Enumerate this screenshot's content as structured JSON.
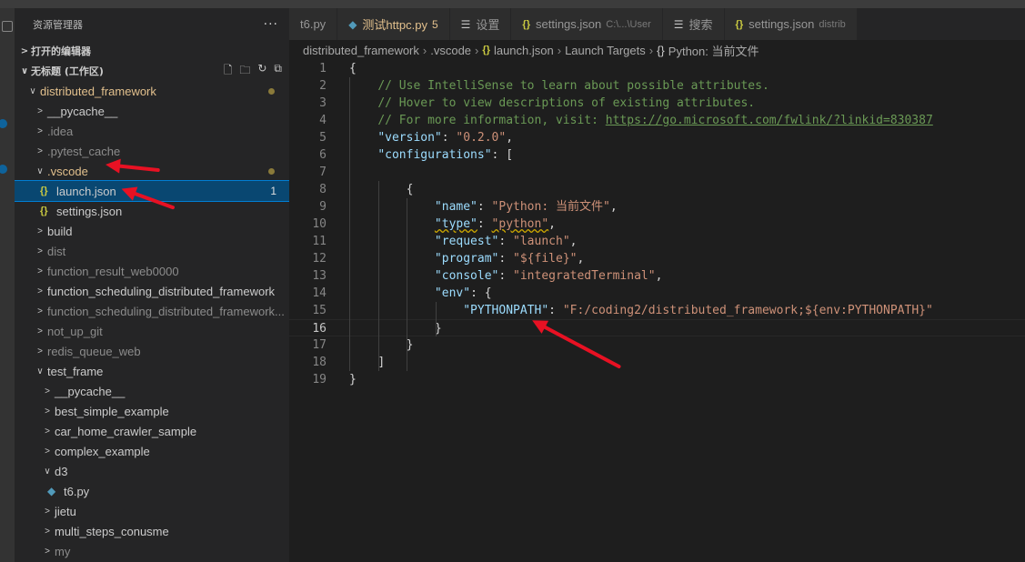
{
  "sidebar": {
    "title": "资源管理器",
    "open_editors_label": "打开的编辑器",
    "workspace_label": "无标题 (工作区)",
    "tree": [
      {
        "label": "distributed_framework",
        "chev": "∨",
        "indent": 1,
        "kind": "folder",
        "modified": true
      },
      {
        "label": "__pycache__",
        "chev": ">",
        "indent": 2,
        "kind": "folder",
        "ignored": false
      },
      {
        "label": ".idea",
        "chev": ">",
        "indent": 2,
        "kind": "folder",
        "ignored": true
      },
      {
        "label": ".pytest_cache",
        "chev": ">",
        "indent": 2,
        "kind": "folder",
        "ignored": true
      },
      {
        "label": ".vscode",
        "chev": "∨",
        "indent": 2,
        "kind": "folder",
        "modified": true
      },
      {
        "label": "launch.json",
        "indent": 3,
        "kind": "json",
        "selected": true,
        "count": "1"
      },
      {
        "label": "settings.json",
        "indent": 3,
        "kind": "json"
      },
      {
        "label": "build",
        "chev": ">",
        "indent": 2,
        "kind": "folder"
      },
      {
        "label": "dist",
        "chev": ">",
        "indent": 2,
        "kind": "folder",
        "ignored": true
      },
      {
        "label": "function_result_web0000",
        "chev": ">",
        "indent": 2,
        "kind": "folder",
        "ignored": true
      },
      {
        "label": "function_scheduling_distributed_framework",
        "chev": ">",
        "indent": 2,
        "kind": "folder"
      },
      {
        "label": "function_scheduling_distributed_framework...",
        "chev": ">",
        "indent": 2,
        "kind": "folder",
        "ignored": true
      },
      {
        "label": "not_up_git",
        "chev": ">",
        "indent": 2,
        "kind": "folder",
        "ignored": true
      },
      {
        "label": "redis_queue_web",
        "chev": ">",
        "indent": 2,
        "kind": "folder",
        "ignored": true
      },
      {
        "label": "test_frame",
        "chev": "∨",
        "indent": 2,
        "kind": "folder"
      },
      {
        "label": "__pycache__",
        "chev": ">",
        "indent": 3,
        "kind": "folder"
      },
      {
        "label": "best_simple_example",
        "chev": ">",
        "indent": 3,
        "kind": "folder"
      },
      {
        "label": "car_home_crawler_sample",
        "chev": ">",
        "indent": 3,
        "kind": "folder"
      },
      {
        "label": "complex_example",
        "chev": ">",
        "indent": 3,
        "kind": "folder"
      },
      {
        "label": "d3",
        "chev": "∨",
        "indent": 3,
        "kind": "folder"
      },
      {
        "label": "t6.py",
        "indent": 4,
        "kind": "py"
      },
      {
        "label": "jietu",
        "chev": ">",
        "indent": 3,
        "kind": "folder"
      },
      {
        "label": "multi_steps_conusme",
        "chev": ">",
        "indent": 3,
        "kind": "folder"
      },
      {
        "label": "my",
        "chev": ">",
        "indent": 3,
        "kind": "folder",
        "ignored": true
      }
    ]
  },
  "tabs": [
    {
      "label": "t6.py",
      "icon": ""
    },
    {
      "label": "测试httpc.py",
      "icon": "python-icon",
      "badge": "5",
      "modified": true
    },
    {
      "label": "设置",
      "icon": "settings-icon"
    },
    {
      "label": "settings.json",
      "icon": "json-icon",
      "desc": "C:\\...\\User"
    },
    {
      "label": "搜索",
      "icon": "search-icon"
    },
    {
      "label": "settings.json",
      "icon": "json-icon",
      "desc": "distrib"
    }
  ],
  "breadcrumb": [
    "distributed_framework",
    ".vscode",
    "launch.json",
    "Launch Targets",
    "Python: 当前文件"
  ],
  "editor": {
    "active_line": 16,
    "lines": [
      [
        [
          "{",
          "t-pun"
        ]
      ],
      [
        [
          "    ",
          ""
        ],
        [
          "// Use IntelliSense to learn about possible attributes.",
          "t-com"
        ]
      ],
      [
        [
          "    ",
          ""
        ],
        [
          "// Hover to view descriptions of existing attributes.",
          "t-com"
        ]
      ],
      [
        [
          "    ",
          ""
        ],
        [
          "// For more information, visit: ",
          "t-com"
        ],
        [
          "https://go.microsoft.com/fwlink/?linkid=830387",
          "t-link"
        ]
      ],
      [
        [
          "    ",
          ""
        ],
        [
          "\"version\"",
          "t-key"
        ],
        [
          ": ",
          "t-pun"
        ],
        [
          "\"0.2.0\"",
          "t-str"
        ],
        [
          ",",
          "t-pun"
        ]
      ],
      [
        [
          "    ",
          ""
        ],
        [
          "\"configurations\"",
          "t-key"
        ],
        [
          ": [",
          "t-pun"
        ]
      ],
      [
        [
          "",
          ""
        ]
      ],
      [
        [
          "        ",
          ""
        ],
        [
          "{",
          "t-pun"
        ]
      ],
      [
        [
          "            ",
          ""
        ],
        [
          "\"name\"",
          "t-key"
        ],
        [
          ": ",
          "t-pun"
        ],
        [
          "\"Python: 当前文件\"",
          "t-str"
        ],
        [
          ",",
          "t-pun"
        ]
      ],
      [
        [
          "            ",
          ""
        ],
        [
          "\"type\"",
          "t-key squig"
        ],
        [
          ": ",
          "t-pun"
        ],
        [
          "\"python\"",
          "t-str squig"
        ],
        [
          ",",
          "t-pun"
        ]
      ],
      [
        [
          "            ",
          ""
        ],
        [
          "\"request\"",
          "t-key"
        ],
        [
          ": ",
          "t-pun"
        ],
        [
          "\"launch\"",
          "t-str"
        ],
        [
          ",",
          "t-pun"
        ]
      ],
      [
        [
          "            ",
          ""
        ],
        [
          "\"program\"",
          "t-key"
        ],
        [
          ": ",
          "t-pun"
        ],
        [
          "\"${file}\"",
          "t-str"
        ],
        [
          ",",
          "t-pun"
        ]
      ],
      [
        [
          "            ",
          ""
        ],
        [
          "\"console\"",
          "t-key"
        ],
        [
          ": ",
          "t-pun"
        ],
        [
          "\"integratedTerminal\"",
          "t-str"
        ],
        [
          ",",
          "t-pun"
        ]
      ],
      [
        [
          "            ",
          ""
        ],
        [
          "\"env\"",
          "t-key"
        ],
        [
          ": {",
          "t-pun"
        ]
      ],
      [
        [
          "                ",
          ""
        ],
        [
          "\"PYTHONPATH\"",
          "t-key"
        ],
        [
          ": ",
          "t-pun"
        ],
        [
          "\"F:/coding2/distributed_framework;${env:PYTHONPATH}\"",
          "t-str"
        ]
      ],
      [
        [
          "            ",
          ""
        ],
        [
          "}",
          "t-pun"
        ]
      ],
      [
        [
          "        ",
          ""
        ],
        [
          "}",
          "t-pun"
        ]
      ],
      [
        [
          "    ",
          ""
        ],
        [
          "]",
          "t-pun"
        ]
      ],
      [
        [
          "}",
          "t-pun"
        ]
      ]
    ]
  },
  "colors": {
    "accent": "#007fd4",
    "selection": "#094771",
    "annotation_arrow": "#e81123"
  }
}
